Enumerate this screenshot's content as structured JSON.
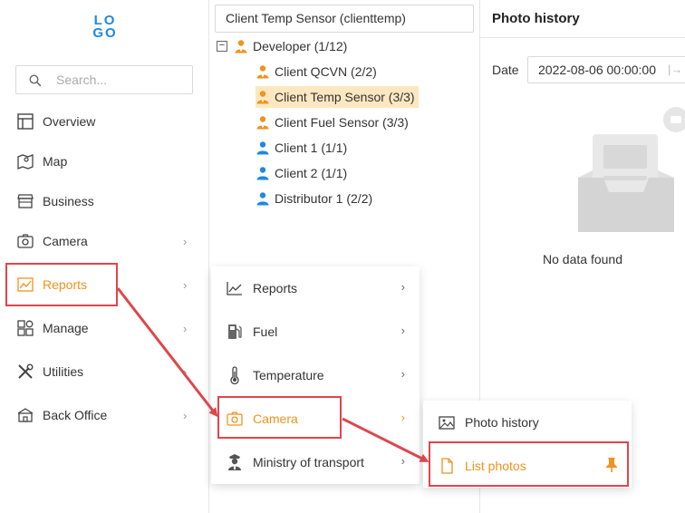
{
  "logo": {
    "line1": "LO",
    "line2": "GO"
  },
  "search": {
    "placeholder": "Search..."
  },
  "sidebar": {
    "items": [
      {
        "label": "Overview",
        "icon": "layout-icon"
      },
      {
        "label": "Map",
        "icon": "map-icon"
      },
      {
        "label": "Business",
        "icon": "store-icon"
      },
      {
        "label": "Camera",
        "icon": "camera-icon",
        "chevron": "›"
      },
      {
        "label": "Reports",
        "icon": "chart-icon",
        "chevron": "›",
        "active": true
      },
      {
        "label": "Manage",
        "icon": "apps-icon",
        "chevron": "›"
      },
      {
        "label": "Utilities",
        "icon": "tools-icon",
        "chevron": "›"
      },
      {
        "label": "Back Office",
        "icon": "office-icon",
        "chevron": "›"
      }
    ]
  },
  "tree": {
    "selector": "Client Temp Sensor (clienttemp)",
    "collapse_symbol": "−",
    "nodes": [
      {
        "label": "Developer (1/12)",
        "icon": "user-orange-icon"
      },
      {
        "label": "Client QCVN (2/2)",
        "icon": "user-orange-icon"
      },
      {
        "label": "Client Temp Sensor (3/3)",
        "icon": "user-orange-icon",
        "selected": true
      },
      {
        "label": "Client Fuel Sensor (3/3)",
        "icon": "user-orange-icon"
      },
      {
        "label": "Client 1 (1/1)",
        "icon": "user-blue-icon"
      },
      {
        "label": "Client 2 (1/1)",
        "icon": "user-blue-icon"
      },
      {
        "label": "Distributor 1 (2/2)",
        "icon": "user-blue-icon"
      }
    ]
  },
  "right_panel": {
    "title": "Photo history",
    "date_label": "Date",
    "date_value": "2022-08-06 00:00:00",
    "date_arrow": "|→",
    "empty_text": "No data found"
  },
  "reports_menu": {
    "items": [
      {
        "label": "Reports",
        "icon": "line-chart-icon",
        "chevron": "›"
      },
      {
        "label": "Fuel",
        "icon": "fuel-icon",
        "chevron": "›"
      },
      {
        "label": "Temperature",
        "icon": "thermometer-icon",
        "chevron": "›"
      },
      {
        "label": "Camera",
        "icon": "camera-icon",
        "chevron": "›",
        "active": true
      },
      {
        "label": "Ministry of transport",
        "icon": "officer-icon",
        "chevron": "›"
      }
    ]
  },
  "camera_menu": {
    "items": [
      {
        "label": "Photo history",
        "icon": "image-icon"
      },
      {
        "label": "List photos",
        "icon": "file-icon",
        "pinned": true,
        "active": true
      }
    ]
  },
  "colors": {
    "accent": "#f0921b",
    "highlight": "#e0454c",
    "brand": "#1e88e5",
    "selected_bg": "#fde7c0"
  }
}
